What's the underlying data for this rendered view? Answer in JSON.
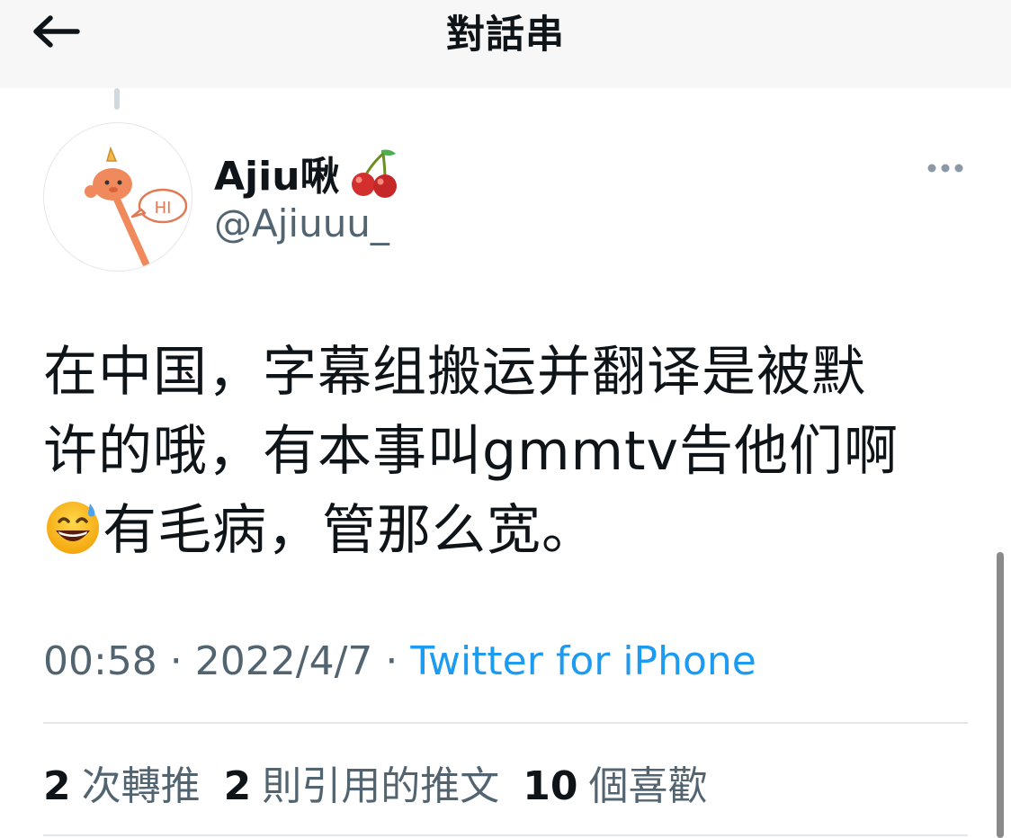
{
  "header": {
    "title": "對話串",
    "back_icon": "arrow-left-icon"
  },
  "author": {
    "display_name": "Ajiu啾",
    "name_emoji": "cherries-icon",
    "handle": "@Ajiuuu_",
    "avatar_text": "HI"
  },
  "tweet": {
    "line1": "在中国，字幕组搬运并翻译是被默",
    "line2": "许的哦，有本事叫gmmtv告他们啊",
    "line3_emoji": "grinning-face-with-sweat-icon",
    "line3": "有毛病，管那么宽。"
  },
  "meta": {
    "time": "00:58",
    "sep1": " · ",
    "date": "2022/4/7",
    "sep2": " · ",
    "source": "Twitter for iPhone"
  },
  "stats": {
    "retweets_count": "2",
    "retweets_label": "次轉推",
    "quotes_count": "2",
    "quotes_label": "則引用的推文",
    "likes_count": "10",
    "likes_label": "個喜歡"
  },
  "colors": {
    "link": "#1d9bf0",
    "secondary_text": "#536471",
    "primary_text": "#0f1419",
    "header_bg": "#f7f7f7"
  }
}
